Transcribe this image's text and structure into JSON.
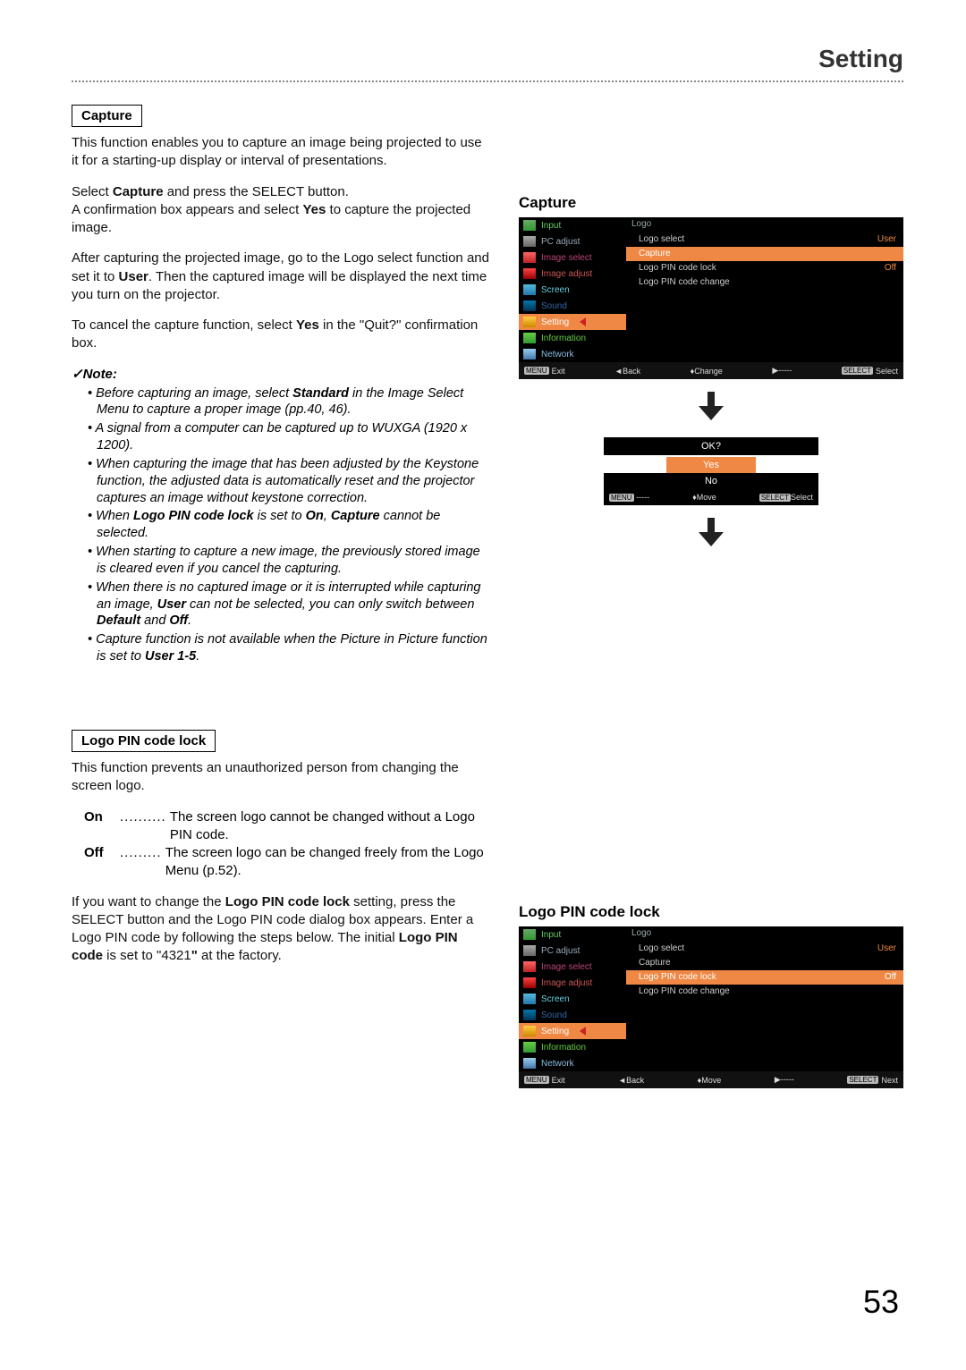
{
  "header": {
    "title": "Setting"
  },
  "capture": {
    "label": "Capture",
    "p1": "This function enables you to capture an image being projected to use it for a starting-up display or interval of presentations.",
    "p2a": "Select ",
    "p2b": "Capture",
    "p2c": " and press the SELECT button.",
    "p2d": "A confirmation box appears and select ",
    "p2e": "Yes",
    "p2f": " to capture the projected image.",
    "p3a": "After capturing the projected image, go to the Logo select function and set it to ",
    "p3b": "User",
    "p3c": ". Then the captured image will be displayed the next time you turn on the projector.",
    "p4a": "To cancel the capture function, select ",
    "p4b": "Yes",
    "p4c": " in the \"Quit?\" confirmation box."
  },
  "note": {
    "title": "✓Note:",
    "n1a": "Before capturing an image, select ",
    "n1b": "Standard",
    "n1c": " in the Image Select Menu to capture a proper image (pp.40, 46).",
    "n2": "A signal from a computer can be captured up to WUXGA (1920 x 1200).",
    "n3": "When capturing the image that has been adjusted by the Keystone function, the adjusted data is automatically reset and the projector captures an image without keystone correction.",
    "n4a": "When ",
    "n4b": "Logo PIN code lock",
    "n4c": " is set to ",
    "n4d": "On",
    "n4e": ", ",
    "n4f": "Capture",
    "n4g": " cannot be selected.",
    "n5": "When starting to capture a new image, the previously stored image is cleared even if you cancel the capturing.",
    "n6a": "When there is no captured image or it is interrupted while capturing an image, ",
    "n6b": "User",
    "n6c": " can not be selected, you can only switch between ",
    "n6d": "Default",
    "n6e": " and ",
    "n6f": "Off",
    "n6g": ".",
    "n7a": "Capture function is not available when the Picture in Picture function is set to ",
    "n7b": "User 1-5",
    "n7c": "."
  },
  "pin": {
    "label": "Logo PIN code lock",
    "p1": "This function prevents an unauthorized person from changing the screen logo.",
    "on_key": "On",
    "on_dots": "..........",
    "on_val": "The screen logo cannot be changed without a Logo PIN code.",
    "off_key": "Off",
    "off_dots": ".........",
    "off_val": "The screen logo can be changed freely from the Logo Menu (p.52).",
    "p2a": "If you want to change the ",
    "p2b": "Logo PIN code lock",
    "p2c": " setting, press the SELECT button and the Logo PIN code dialog box appears. Enter a Logo PIN code by following the steps below. The initial ",
    "p2d": "Logo PIN code",
    "p2e": " is set to \"4321",
    "p2f": "\"",
    "p2g": " at the factory."
  },
  "right": {
    "capture_heading": "Capture",
    "pin_heading": "Logo PIN code lock"
  },
  "osd": {
    "sidebar": [
      "Input",
      "PC adjust",
      "Image select",
      "Image adjust",
      "Screen",
      "Sound",
      "Setting",
      "Information",
      "Network"
    ],
    "right_head": "Logo",
    "items1": [
      {
        "label": "Logo select",
        "val": "User"
      },
      {
        "label": "Capture",
        "val": ""
      },
      {
        "label": "Logo PIN code lock",
        "val": "Off"
      },
      {
        "label": "Logo PIN code change",
        "val": ""
      }
    ],
    "items2": [
      {
        "label": "Logo select",
        "val": "User"
      },
      {
        "label": "Capture",
        "val": ""
      },
      {
        "label": "Logo PIN code lock",
        "val": "Off"
      },
      {
        "label": "Logo PIN code change",
        "val": ""
      }
    ],
    "footer1": {
      "exit": "Exit",
      "exit_key": "MENU",
      "back": "◄Back",
      "change": "♦Change",
      "dash": "▶-----",
      "select": "Select",
      "select_key": "SELECT"
    },
    "footer2": {
      "exit": "Exit",
      "exit_key": "MENU",
      "back": "◄Back",
      "move": "♦Move",
      "dash": "▶-----",
      "next": "Next",
      "next_key": "SELECT"
    },
    "confirm": {
      "ok": "OK?",
      "yes": "Yes",
      "no": "No"
    },
    "confirm_footer": {
      "dash": "-----",
      "key": "MENU",
      "move": "♦Move",
      "select": "Select",
      "select_key": "SELECT"
    }
  },
  "page_number": "53"
}
